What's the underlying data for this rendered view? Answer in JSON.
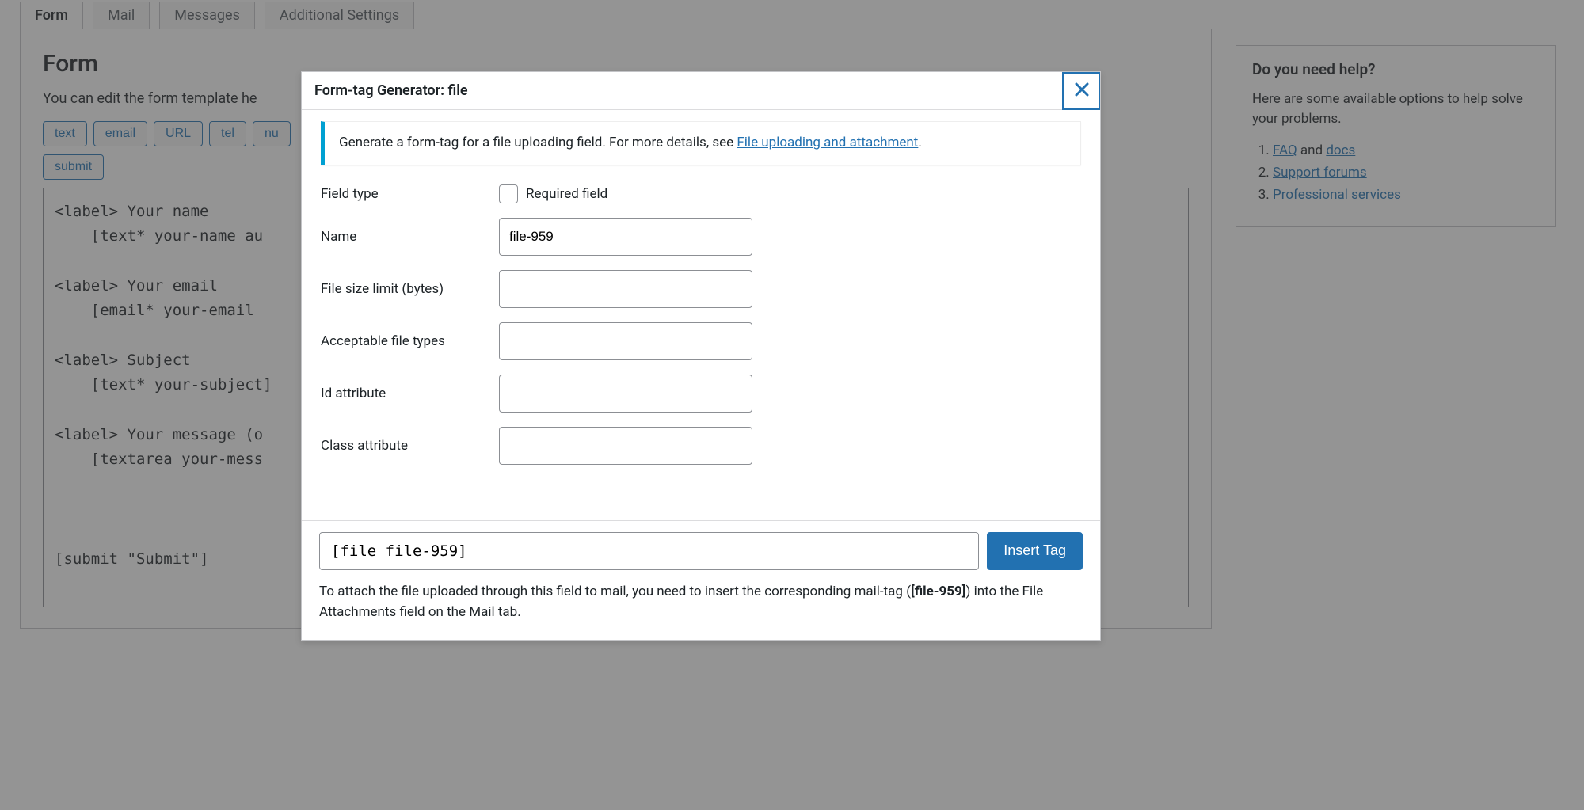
{
  "tabs": {
    "form": "Form",
    "mail": "Mail",
    "messages": "Messages",
    "additional": "Additional Settings"
  },
  "panel": {
    "heading": "Form",
    "desc": "You can edit the form template he",
    "tag_buttons": [
      "text",
      "email",
      "URL",
      "tel",
      "nu"
    ],
    "submit_button": "submit",
    "textarea_value": "<label> Your name\n    [text* your-name au\n\n<label> Your email\n    [email* your-email \n\n<label> Subject\n    [text* your-subject]\n\n<label> Your message (o\n    [textarea your-mess\n\n\n\n[submit \"Submit\"]"
  },
  "help": {
    "title": "Do you need help?",
    "intro": "Here are some available options to help solve your problems.",
    "faq_label": "FAQ",
    "and_text": " and ",
    "docs_label": "docs",
    "support_label": "Support forums",
    "pro_label": "Professional services"
  },
  "modal": {
    "title": "Form-tag Generator: file",
    "info_prefix": "Generate a form-tag for a file uploading field. For more details, see ",
    "info_link": "File uploading and attachment",
    "info_suffix": ".",
    "labels": {
      "field_type": "Field type",
      "required": "Required field",
      "name": "Name",
      "size_limit": "File size limit (bytes)",
      "file_types": "Acceptable file types",
      "id_attr": "Id attribute",
      "class_attr": "Class attribute"
    },
    "values": {
      "name": "file-959",
      "size_limit": "",
      "file_types": "",
      "id_attr": "",
      "class_attr": ""
    },
    "footer": {
      "tag_output": "[file file-959]",
      "insert_label": "Insert Tag",
      "note_prefix": "To attach the file uploaded through this field to mail, you need to insert the corresponding mail-tag (",
      "mail_tag": "[file-959]",
      "note_suffix": ") into the File Attachments field on the Mail tab."
    }
  }
}
